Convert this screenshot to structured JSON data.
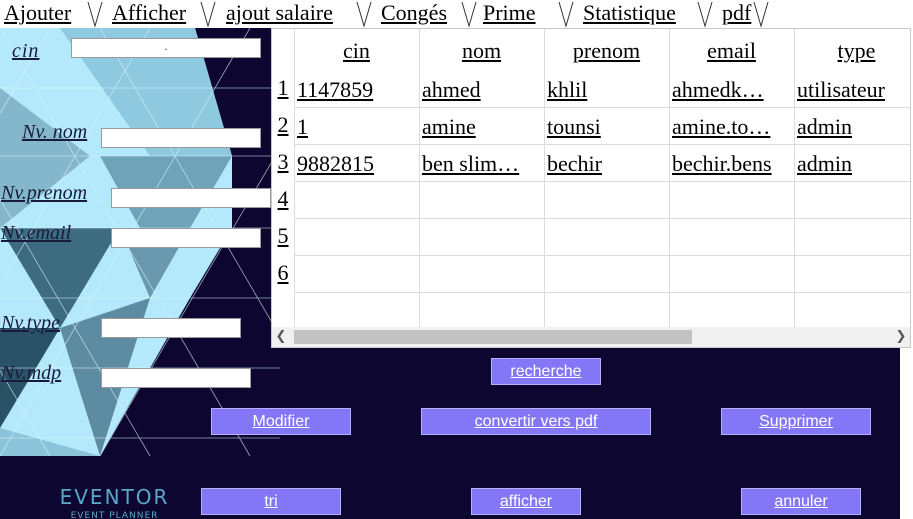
{
  "tabs": [
    "Ajouter",
    "Afficher",
    "ajout salaire",
    "Congés",
    " Prime",
    "Statistique",
    "pdf"
  ],
  "form": {
    "cin_label": "cin",
    "cin_value": ".",
    "nom_label": "Nv. nom",
    "nom_value": "",
    "prenom_label": "Nv.prenom",
    "prenom_value": "",
    "email_label": "Nv.email",
    "email_value": "",
    "type_label": "Nv.type",
    "type_value": "",
    "mdp_label": "Nv.mdp",
    "mdp_value": ""
  },
  "table": {
    "columns": [
      "cin",
      "nom",
      "prenom",
      "email",
      "type"
    ],
    "row_numbers": [
      "1",
      "2",
      "3",
      "4",
      "5",
      "6"
    ],
    "rows": [
      [
        "1147859",
        "ahmed",
        "khlil",
        "ahmedk…",
        "utilisateur"
      ],
      [
        "1",
        "amine",
        "tounsi",
        "amine.to…",
        "admin"
      ],
      [
        "9882815",
        "ben slim…",
        "bechir",
        "bechir.bens",
        "admin"
      ],
      [
        "",
        "",
        "",
        "",
        ""
      ],
      [
        "",
        "",
        "",
        "",
        ""
      ],
      [
        "",
        "",
        "",
        "",
        ""
      ]
    ],
    "scroll_left_icon": "chevron-left-icon",
    "scroll_right_icon": "chevron-right-icon"
  },
  "buttons": {
    "recherche": "recherche",
    "modifier": "Modifier",
    "convertir": "convertir vers pdf",
    "supprimer": "Supprimer",
    "tri": "tri",
    "afficher": "afficher",
    "annuler": "annuler"
  },
  "logo": {
    "name": "EVENTOR",
    "tagline": "EVENT PLANNER"
  },
  "colors": {
    "panel_bg": "#0c0630",
    "button_bg": "#8377f7",
    "art_light": "#b3e9fb",
    "art_mid": "#84b7cc",
    "art_dark": "#3d6b80",
    "logo": "#5aa8c8"
  }
}
